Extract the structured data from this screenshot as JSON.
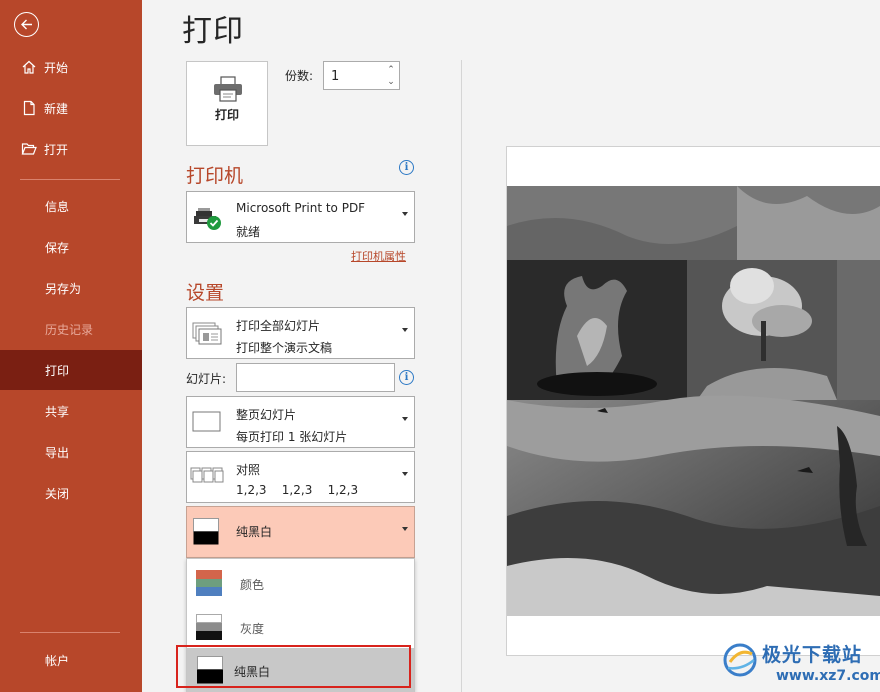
{
  "sidebar": {
    "items": [
      {
        "key": "home",
        "label": "开始",
        "icon": "home-icon"
      },
      {
        "key": "new",
        "label": "新建",
        "icon": "new-file-icon"
      },
      {
        "key": "open",
        "label": "打开",
        "icon": "folder-open-icon"
      },
      {
        "key": "info",
        "label": "信息"
      },
      {
        "key": "save",
        "label": "保存"
      },
      {
        "key": "save-as",
        "label": "另存为"
      },
      {
        "key": "history",
        "label": "历史记录"
      },
      {
        "key": "print",
        "label": "打印"
      },
      {
        "key": "share",
        "label": "共享"
      },
      {
        "key": "export",
        "label": "导出"
      },
      {
        "key": "close",
        "label": "关闭"
      },
      {
        "key": "account",
        "label": "帐户"
      }
    ],
    "active": "print",
    "background": "#b7472a",
    "active_background": "#7a1f12"
  },
  "page": {
    "title": "打印",
    "print_button_label": "打印",
    "copies_label": "份数:",
    "copies_value": "1"
  },
  "printer": {
    "section_title": "打印机",
    "name": "Microsoft Print to PDF",
    "status": "就绪",
    "properties_link": "打印机属性"
  },
  "settings": {
    "section_title": "设置",
    "range": {
      "line1": "打印全部幻灯片",
      "line2": "打印整个演示文稿"
    },
    "slides_label": "幻灯片:",
    "slides_value": "",
    "layout": {
      "line1": "整页幻灯片",
      "line2": "每页打印 1 张幻灯片"
    },
    "collate": {
      "line1": "对照",
      "line2": "1,2,3    1,2,3    1,2,3"
    },
    "color_mode": {
      "selected": "纯黑白"
    },
    "color_options": [
      "颜色",
      "灰度",
      "纯黑白"
    ]
  },
  "watermark": {
    "text": "极光下载站",
    "url": "www.xz7.com"
  },
  "colors": {
    "accent": "#b7472a",
    "highlight": "#fccab8",
    "annotation": "#d8231c",
    "info": "#2b78c5"
  }
}
